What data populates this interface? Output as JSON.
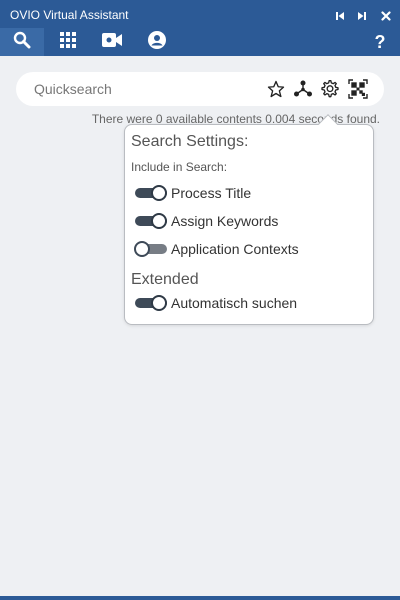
{
  "window": {
    "title": "OVIO Virtual Assistant",
    "buttons": [
      "skip-back-icon",
      "skip-forward-icon",
      "close-icon"
    ]
  },
  "nav": {
    "tabs": [
      {
        "icon": "search-icon",
        "active": true
      },
      {
        "icon": "grid-icon",
        "active": false
      },
      {
        "icon": "video-icon",
        "active": false
      },
      {
        "icon": "user-circle-icon",
        "active": false
      }
    ],
    "help_label": "?"
  },
  "search": {
    "placeholder": "Quicksearch",
    "value": "",
    "icons": [
      "star-icon",
      "network-icon",
      "gear-icon",
      "qr-code-icon"
    ]
  },
  "status": {
    "text": "There were 0 available contents 0.004 seconds found."
  },
  "settings_popover": {
    "title": "Search Settings:",
    "include_label": "Include in Search:",
    "options": [
      {
        "label": "Process Title",
        "enabled": true
      },
      {
        "label": "Assign Keywords",
        "enabled": true
      },
      {
        "label": "Application Contexts",
        "enabled": false
      }
    ],
    "extended_title": "Extended",
    "extended_options": [
      {
        "label": "Automatisch suchen",
        "enabled": true
      }
    ]
  },
  "colors": {
    "header": "#2c5a96",
    "active_tab": "#3a6aa6",
    "background": "#eef0f3",
    "toggle_on": "#3e4a58",
    "toggle_off": "#777d85"
  }
}
